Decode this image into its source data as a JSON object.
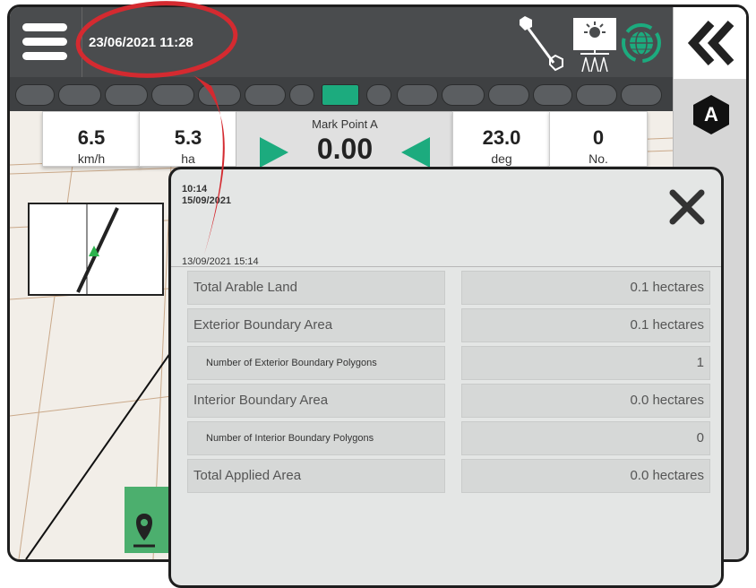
{
  "header": {
    "datetime": "23/06/2021 11:28"
  },
  "status_icons": [
    "boom-icon",
    "sprayer-icon",
    "gnss-globe-icon"
  ],
  "sidebar": {
    "back_icon": "double-chevron-left-icon",
    "mode_badge": "A"
  },
  "sections": {
    "count": 15,
    "active_index": 7
  },
  "dashboard": {
    "speed": {
      "value": "6.5",
      "unit": "km/h"
    },
    "area": {
      "value": "5.3",
      "unit": "ha"
    },
    "mark_point": {
      "label": "Mark Point A",
      "value": "0.00"
    },
    "heading": {
      "value": "23.0",
      "unit": "deg"
    },
    "count": {
      "value": "0",
      "unit": "No."
    }
  },
  "panel": {
    "time": "10:14",
    "date": "15/09/2021",
    "job_date": "13/09/2021 15:14",
    "rows": [
      {
        "label": "Total Arable Land",
        "value": "0.1 hectares",
        "sub": false
      },
      {
        "label": "Exterior Boundary Area",
        "value": "0.1 hectares",
        "sub": false
      },
      {
        "label": "Number of Exterior Boundary Polygons",
        "value": "1",
        "sub": true
      },
      {
        "label": "Interior Boundary Area",
        "value": "0.0 hectares",
        "sub": false
      },
      {
        "label": "Number of Interior Boundary Polygons",
        "value": "0",
        "sub": true
      },
      {
        "label": "Total Applied Area",
        "value": "0.0 hectares",
        "sub": false
      }
    ]
  },
  "colors": {
    "accent_green": "#1cab7e",
    "annotation_red": "#d42a30",
    "topbar": "#4a4c4e"
  }
}
